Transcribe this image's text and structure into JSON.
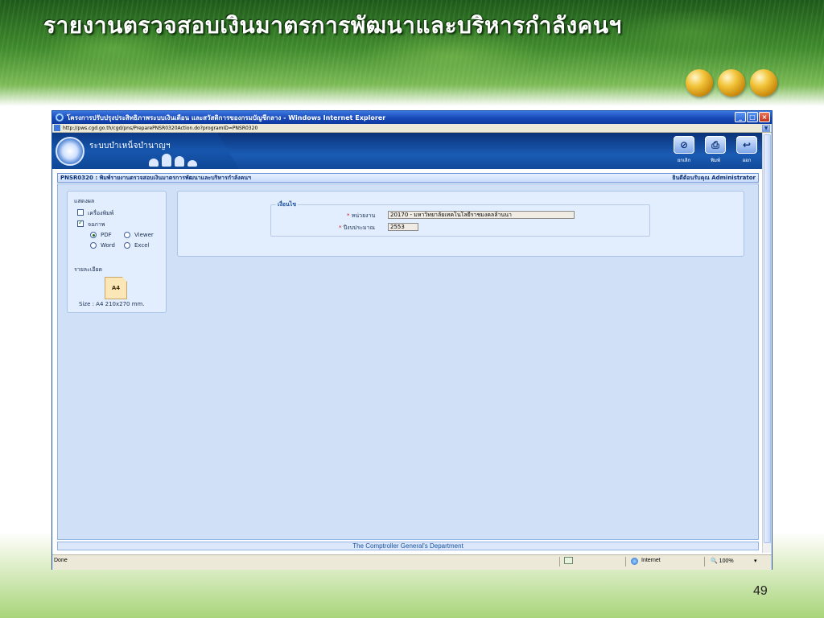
{
  "slide": {
    "title": "รายงานตรวจสอบเงินมาตรการพัฒนาและบริหารกำลังคนฯ",
    "page_number": "49"
  },
  "browser": {
    "title": "โครงการปรับปรุงประสิทธิภาพระบบเงินเดือน และสวัสดิการของกรมบัญชีกลาง - Windows Internet Explorer",
    "url": "http://pws.cgd.go.th/cgd/pns/PreparePNSR0320Action.do?programID=PNSR0320",
    "window_controls": [
      "_",
      "□",
      "×"
    ]
  },
  "app": {
    "system_name": "ระบบบำเหน็จบำนาญฯ",
    "toolbar": {
      "cancel_label": "ยกเลิก",
      "print_label": "พิมพ์",
      "exit_label": "ออก"
    },
    "page_title": "PNSR0320 : พิมพ์รายงานตรวจสอบเงินมาตรการพัฒนาและบริหารกำลังคนฯ",
    "welcome": "ยินดีต้อนรับคุณ Administrator"
  },
  "output_panel": {
    "heading": "แสดงผล",
    "printer_label": "เครื่องพิมพ์",
    "printer_checked": false,
    "screen_label": "จอภาพ",
    "screen_checked": true,
    "formats": [
      {
        "label": "PDF",
        "selected": true
      },
      {
        "label": "Viewer",
        "selected": false
      },
      {
        "label": "Word",
        "selected": false
      },
      {
        "label": "Excel",
        "selected": false
      }
    ],
    "detail_heading": "รายละเอียด",
    "paper_label": "A4",
    "size_text": "Size : A4 210x270 mm."
  },
  "conditions": {
    "legend": "เงื่อนไข",
    "required_mark": "*",
    "unit_label": "หน่วยงาน",
    "unit_value": "20170 - มหาวิทยาลัยเทคโนโลยีราชมงคลล้านนา",
    "year_label": "ปีงบประมาณ",
    "year_value": "2553"
  },
  "footer": "The Comptroller General's Department",
  "statusbar": {
    "status": "Done",
    "zone": "Internet",
    "zoom": "100%"
  },
  "colors": {
    "accent": "#1656ad",
    "panel_bg": "#e2eefd",
    "required": "#d02020"
  }
}
